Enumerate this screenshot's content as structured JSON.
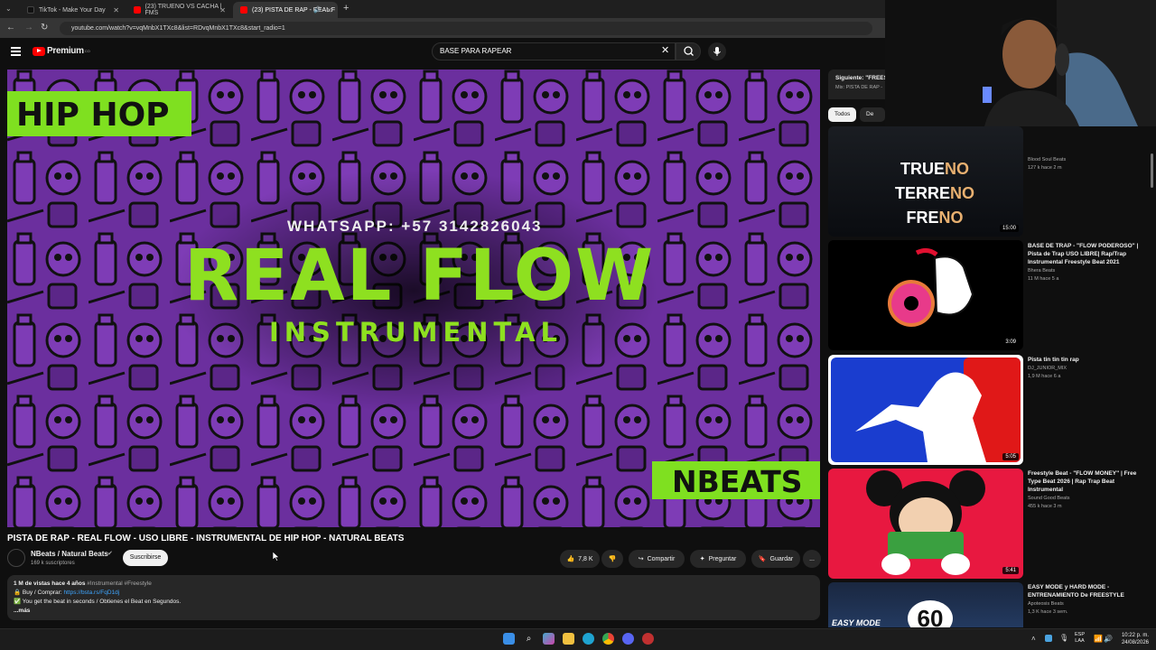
{
  "browser": {
    "tabs": [
      {
        "title": "TikTok - Make Your Day",
        "active": false,
        "color": "#111111"
      },
      {
        "title": "(23) TRUENO VS CACHA | FMS",
        "active": false,
        "color": "#ff0000"
      },
      {
        "title": "(23) PISTA DE RAP - REAL F",
        "active": true,
        "color": "#ff0000"
      }
    ],
    "new_tab": "+",
    "url": "youtube.com/watch?v=vqMnbX1TXc8&list=RDvqMnbX1TXc8&start_radio=1"
  },
  "youtube": {
    "logo_text": "Premium",
    "logo_sup": "CO",
    "search_value": "BASE PARA RAPEAR"
  },
  "video": {
    "art_hiphop": "HIP HOP",
    "art_whatsapp": "WHATSAPP: +57 3142826043",
    "art_title": "REAL FLOW",
    "art_sub": "INSTRUMENTAL",
    "art_brand": "NBEATS",
    "title": "PISTA DE RAP - REAL FLOW - USO LIBRE - INSTRUMENTAL DE HIP HOP - NATURAL BEATS",
    "channel": "NBeats / Natural Beats",
    "subs": "169 k suscriptores",
    "subscribe": "Suscribirse",
    "likes": "7,8 K",
    "share": "Compartir",
    "ask": "Preguntar",
    "save": "Guardar",
    "more": "..."
  },
  "description": {
    "stats": "1 M de vistas  hace 4 años",
    "tags": "#Instrumental #Freestyle",
    "buy_label": "Buy / Comprar:",
    "buy_link": "https://bsta.rs/FqD1dj",
    "line2": "You get the beat in seconds / Obtienes el Beat en Segundos.",
    "more": "...más"
  },
  "sidebar": {
    "up_next": "Siguiente: \"FREES",
    "mix": "Mix: PISTA DE RAP -",
    "chips": [
      "Todos",
      "De NBe"
    ],
    "items": [
      {
        "thumb_lines": [
          "TRUE",
          "NO",
          "TERRE",
          "NO",
          "FRE",
          "NO"
        ],
        "duration": "15:00",
        "title": "",
        "channel": "Blood Soul Beats",
        "views": "127 k  hace 2 m"
      },
      {
        "duration": "3:09",
        "title": "BASE DE TRAP - \"FLOW PODEROSO\" | Pista de Trap USO LIBRE| Rap/Trap Instrumental Freestyle Beat 2021",
        "channel": "Bhera Beats",
        "views": "11 M  hace 5 a"
      },
      {
        "duration": "5:05",
        "title": "Pista tin tin tin rap",
        "channel": "DJ_JUNIOR_MIX",
        "views": "1,9 M  hace 6 a"
      },
      {
        "duration": "5:41",
        "title": "Freestyle Beat - \"FLOW MONEY\" | Free Type Beat 2026 | Rap Trap Beat Instrumental",
        "channel": "Sound Good Beats",
        "views": "455 k  hace 3 m"
      },
      {
        "thumb_text": [
          "EASY MODE",
          "60"
        ],
        "title": "EASY MODE y HARD MODE - ENTRENAMIENTO De FREESTYLE",
        "channel": "Apoteosis Beats",
        "views": "1,3 K  hace 3 sem."
      }
    ]
  },
  "taskbar": {
    "lang": [
      "ESP",
      "LAA"
    ],
    "time": "10:22 p. m.",
    "date": "24/08/2026"
  }
}
